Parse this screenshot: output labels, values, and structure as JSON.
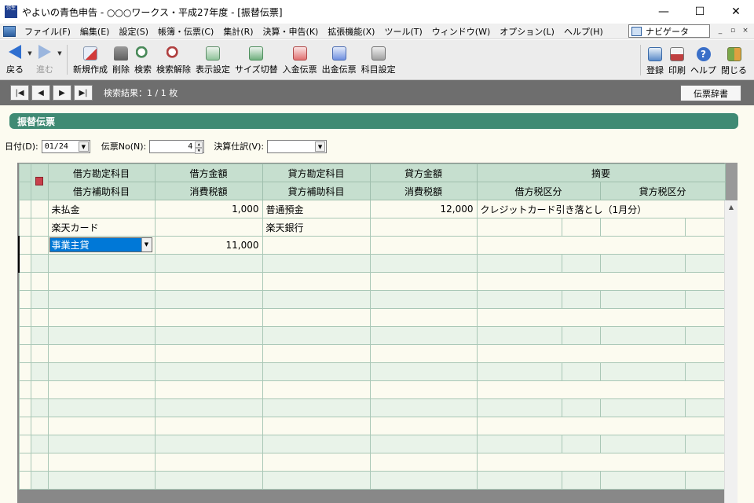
{
  "window": {
    "app_icon_text": "弥生",
    "title": "やよいの青色申告 - ○○○ワークス・平成27年度 - [振替伝票]",
    "minimize": "—",
    "maximize": "☐",
    "close": "✕"
  },
  "menu": {
    "items": [
      "ファイル(F)",
      "編集(E)",
      "設定(S)",
      "帳簿・伝票(C)",
      "集計(R)",
      "決算・申告(K)",
      "拡張機能(X)",
      "ツール(T)",
      "ウィンドウ(W)",
      "オプション(L)",
      "ヘルプ(H)"
    ],
    "navigator": "ナビゲータ",
    "mdi": [
      "_",
      "▫",
      "×"
    ]
  },
  "toolbar": {
    "back": "戻る",
    "forward": "進む",
    "new": "新規作成",
    "delete": "削除",
    "search": "検索",
    "search_clear": "検索解除",
    "display_settings": "表示設定",
    "size_toggle": "サイズ切替",
    "deposit_slip": "入金伝票",
    "payment_slip": "出金伝票",
    "account_settings": "科目設定",
    "register": "登録",
    "print": "印刷",
    "help": "ヘルプ",
    "close": "閉じる"
  },
  "navstrip": {
    "first": "|◀",
    "prev": "◀",
    "next": "▶",
    "last": "▶|",
    "result": "検索結果：1 / 1 枚",
    "dictionary": "伝票辞書"
  },
  "section_title": "振替伝票",
  "filters": {
    "date_label": "日付(D):",
    "date_value": "01/24",
    "slip_no_label": "伝票No(N):",
    "slip_no_value": "4",
    "closing_label": "決算仕訳(V):",
    "closing_value": ""
  },
  "grid": {
    "headers_top": [
      "借方勘定科目",
      "借方金額",
      "貸方勘定科目",
      "貸方金額",
      "摘要"
    ],
    "headers_bottom": [
      "借方補助科目",
      "消費税額",
      "貸方補助科目",
      "消費税額",
      "借方税区分",
      "貸方税区分"
    ],
    "entries": [
      {
        "debit_account": "未払金",
        "debit_amount": "1,000",
        "credit_account": "普通預金",
        "credit_amount": "12,000",
        "description": "クレジットカード引き落とし（1月分）",
        "debit_sub": "楽天カード",
        "debit_tax": "",
        "credit_sub": "楽天銀行",
        "credit_tax": ""
      },
      {
        "debit_account": "事業主貸",
        "debit_amount": "11,000",
        "credit_account": "",
        "credit_amount": "",
        "description": "",
        "debit_sub": "",
        "debit_tax": "",
        "credit_sub": "",
        "credit_tax": ""
      }
    ],
    "empty_rows": 6
  }
}
